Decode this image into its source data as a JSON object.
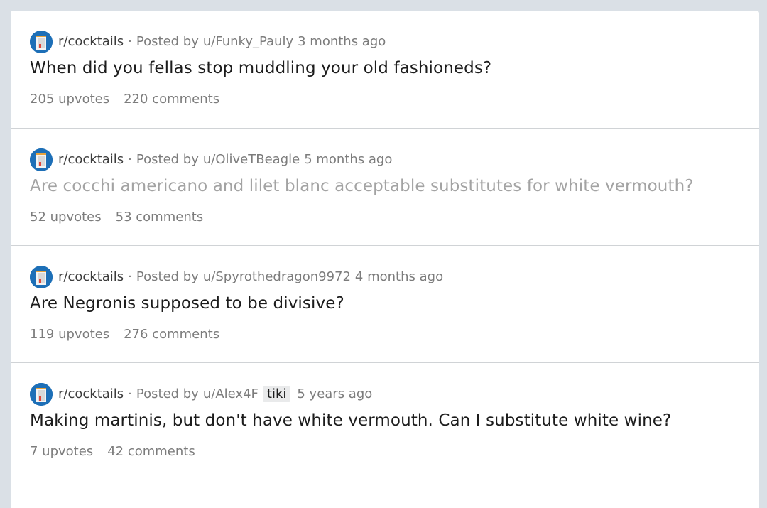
{
  "posts": [
    {
      "subreddit": "r/cocktails",
      "separator": "·",
      "posted_by": "Posted by",
      "user": "u/Funky_Pauly",
      "flair": "",
      "time": "3 months ago",
      "title": "When did you fellas stop muddling your old fashioneds?",
      "visited": false,
      "upvotes": "205 upvotes",
      "comments": "220 comments"
    },
    {
      "subreddit": "r/cocktails",
      "separator": "·",
      "posted_by": "Posted by",
      "user": "u/OliveTBeagle",
      "flair": "",
      "time": "5 months ago",
      "title": "Are cocchi americano and lilet blanc acceptable substitutes for white vermouth?",
      "visited": true,
      "upvotes": "52 upvotes",
      "comments": "53 comments"
    },
    {
      "subreddit": "r/cocktails",
      "separator": "·",
      "posted_by": "Posted by",
      "user": "u/Spyrothedragon9972",
      "flair": "",
      "time": "4 months ago",
      "title": "Are Negronis supposed to be divisive?",
      "visited": false,
      "upvotes": "119 upvotes",
      "comments": "276 comments"
    },
    {
      "subreddit": "r/cocktails",
      "separator": "·",
      "posted_by": "Posted by",
      "user": "u/Alex4F",
      "flair": "tiki",
      "time": "5 years ago",
      "title": "Making martinis, but don't have white vermouth. Can I substitute white wine?",
      "visited": false,
      "upvotes": "7 upvotes",
      "comments": "42 comments"
    }
  ],
  "colors": {
    "background": "#dae0e6",
    "avatar": "#1d6fb7",
    "visited_title": "#a3a3a3"
  },
  "icons": {
    "subreddit_avatar": "cocktails-subreddit-icon"
  }
}
